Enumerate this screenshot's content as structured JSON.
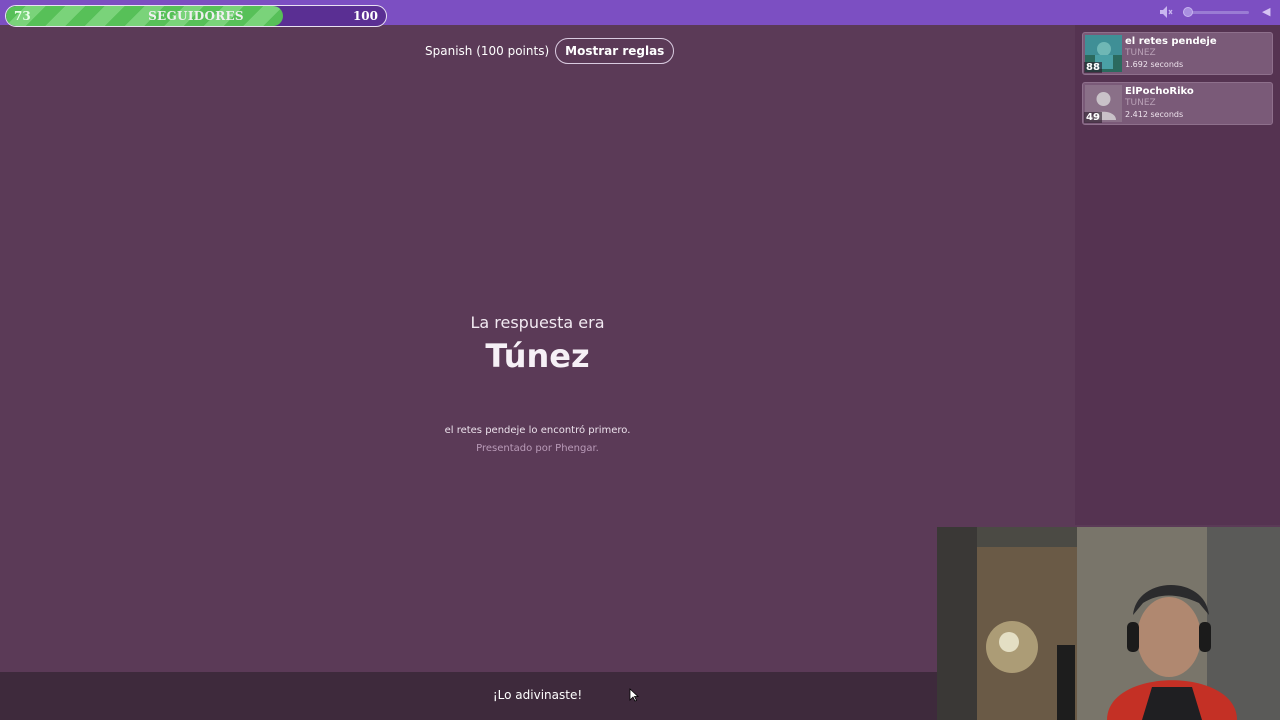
{
  "follower_goal": {
    "current": "73",
    "label": "SEGUIDORES",
    "target": "100",
    "progress": 0.73
  },
  "topbar": {
    "mute_icon": "speaker-muted-icon",
    "volume_level": 0,
    "collapse_icon": "chevron-left-icon"
  },
  "question": {
    "lang_points": "Spanish (100 points)",
    "rules_button": "Mostrar reglas"
  },
  "answer": {
    "intro": "La respuesta era",
    "value": "Túnez",
    "found_first": "el retes pendeje lo encontró primero.",
    "presented_by": "Presentado por Phengar."
  },
  "leaderboard": [
    {
      "name": "el retes pendeje",
      "guess": "TUNEZ",
      "time": "1.692 seconds",
      "score": "88"
    },
    {
      "name": "ElPochoRiko",
      "guess": "TUNEZ",
      "time": "2.412 seconds",
      "score": "49"
    }
  ],
  "bottom": {
    "status": "¡Lo adivinaste!"
  },
  "colors": {
    "background": "#5b3a57",
    "topbar": "#7c4fc2",
    "progress_green": "#57c058"
  }
}
